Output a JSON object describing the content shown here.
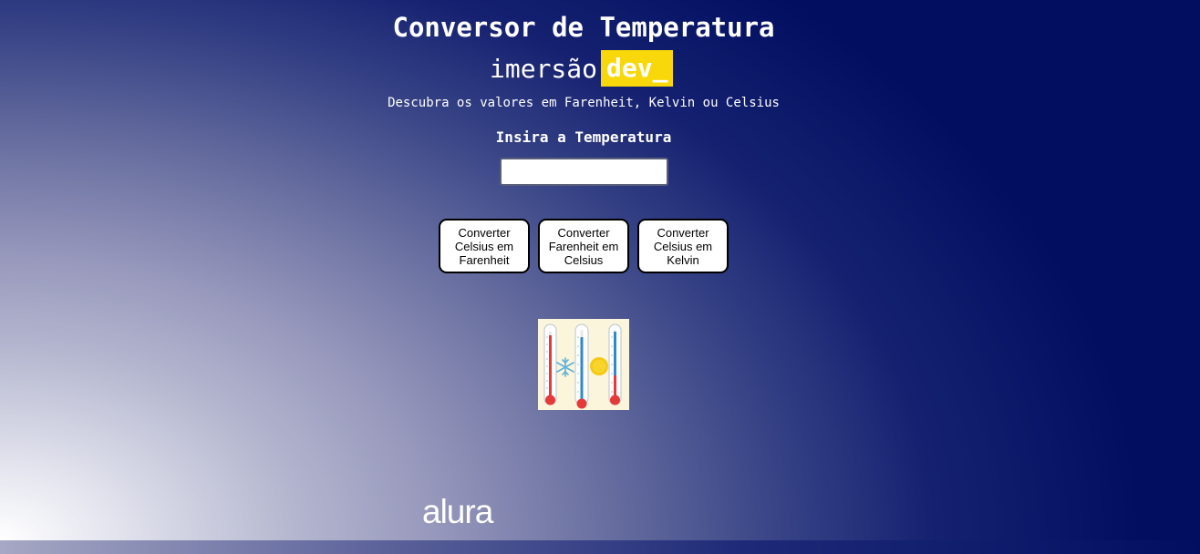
{
  "header": {
    "title": "Conversor de Temperatura",
    "brand_word": "imersão",
    "brand_highlight": "dev_",
    "subtitle": "Descubra os valores em Farenheit, Kelvin ou Celsius"
  },
  "form": {
    "prompt": "Insira a Temperatura",
    "input_value": "",
    "input_placeholder": ""
  },
  "buttons": [
    {
      "label": "Converter Celsius em Farenheit"
    },
    {
      "label": "Converter Farenheit em Celsius"
    },
    {
      "label": "Converter Celsius em Kelvin"
    }
  ],
  "image": {
    "icon": "thermometers-image",
    "items": [
      "thermometer-icon",
      "snowflake-icon",
      "thermometer-icon",
      "sun-icon",
      "thermometer-icon"
    ]
  },
  "footer": {
    "logo": "alura"
  },
  "colors": {
    "background_dark": "#020f61",
    "background_light": "#ffffff",
    "brand_highlight": "#f8d80a",
    "button_border": "#000000",
    "text": "#ffffff"
  }
}
